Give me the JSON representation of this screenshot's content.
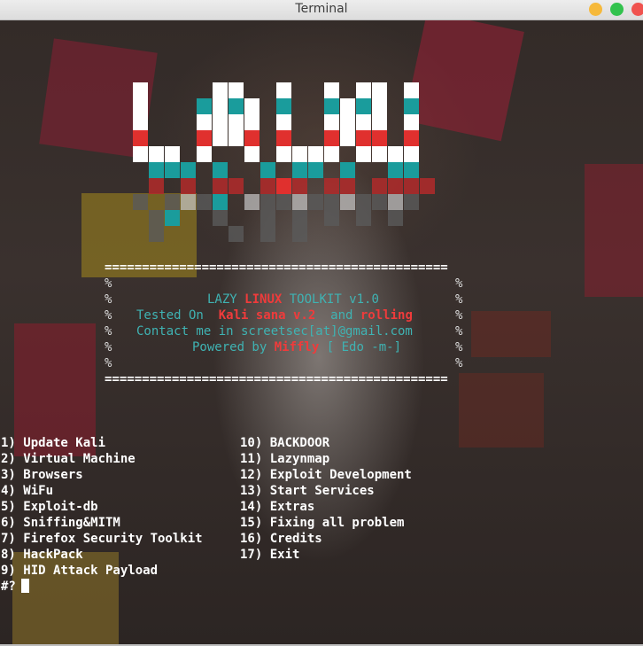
{
  "window": {
    "title": "Terminal"
  },
  "header": {
    "separator": "==============================================",
    "pct": "%",
    "line1_a": "LAZY ",
    "line1_b": "LINUX",
    "line1_c": " TOOLKIT v1.0",
    "line2_a": "Tested On  ",
    "line2_b": "Kali sana v.2",
    "line2_c": "  and ",
    "line2_d": "rolling",
    "line3": "Contact me in screetsec[at]@gmail.com",
    "line4_a": "Powered by ",
    "line4_b": "Miffly",
    "line4_c": " [ Edo -m-]"
  },
  "menu": {
    "left": [
      "1) Update Kali",
      "2) Virtual Machine",
      "3) Browsers",
      "4) WiFu",
      "5) Exploit-db",
      "6) Sniffing&MITM",
      "7) Firefox Security Toolkit",
      "8) HackPack",
      "9) HID Attack Payload"
    ],
    "right": [
      "10) BACKDOOR",
      "11) Lazynmap",
      "12) Exploit Development",
      "13) Start Services",
      "14) Extras",
      "15) Fixing all problem",
      "16) Credits",
      "17) Exit"
    ]
  },
  "prompt": "#?",
  "colors": {
    "cyan": "#3fb3b3",
    "red": "#ef3b3b",
    "banner_teal": "#1a9c9c",
    "banner_red": "#e0302e"
  }
}
